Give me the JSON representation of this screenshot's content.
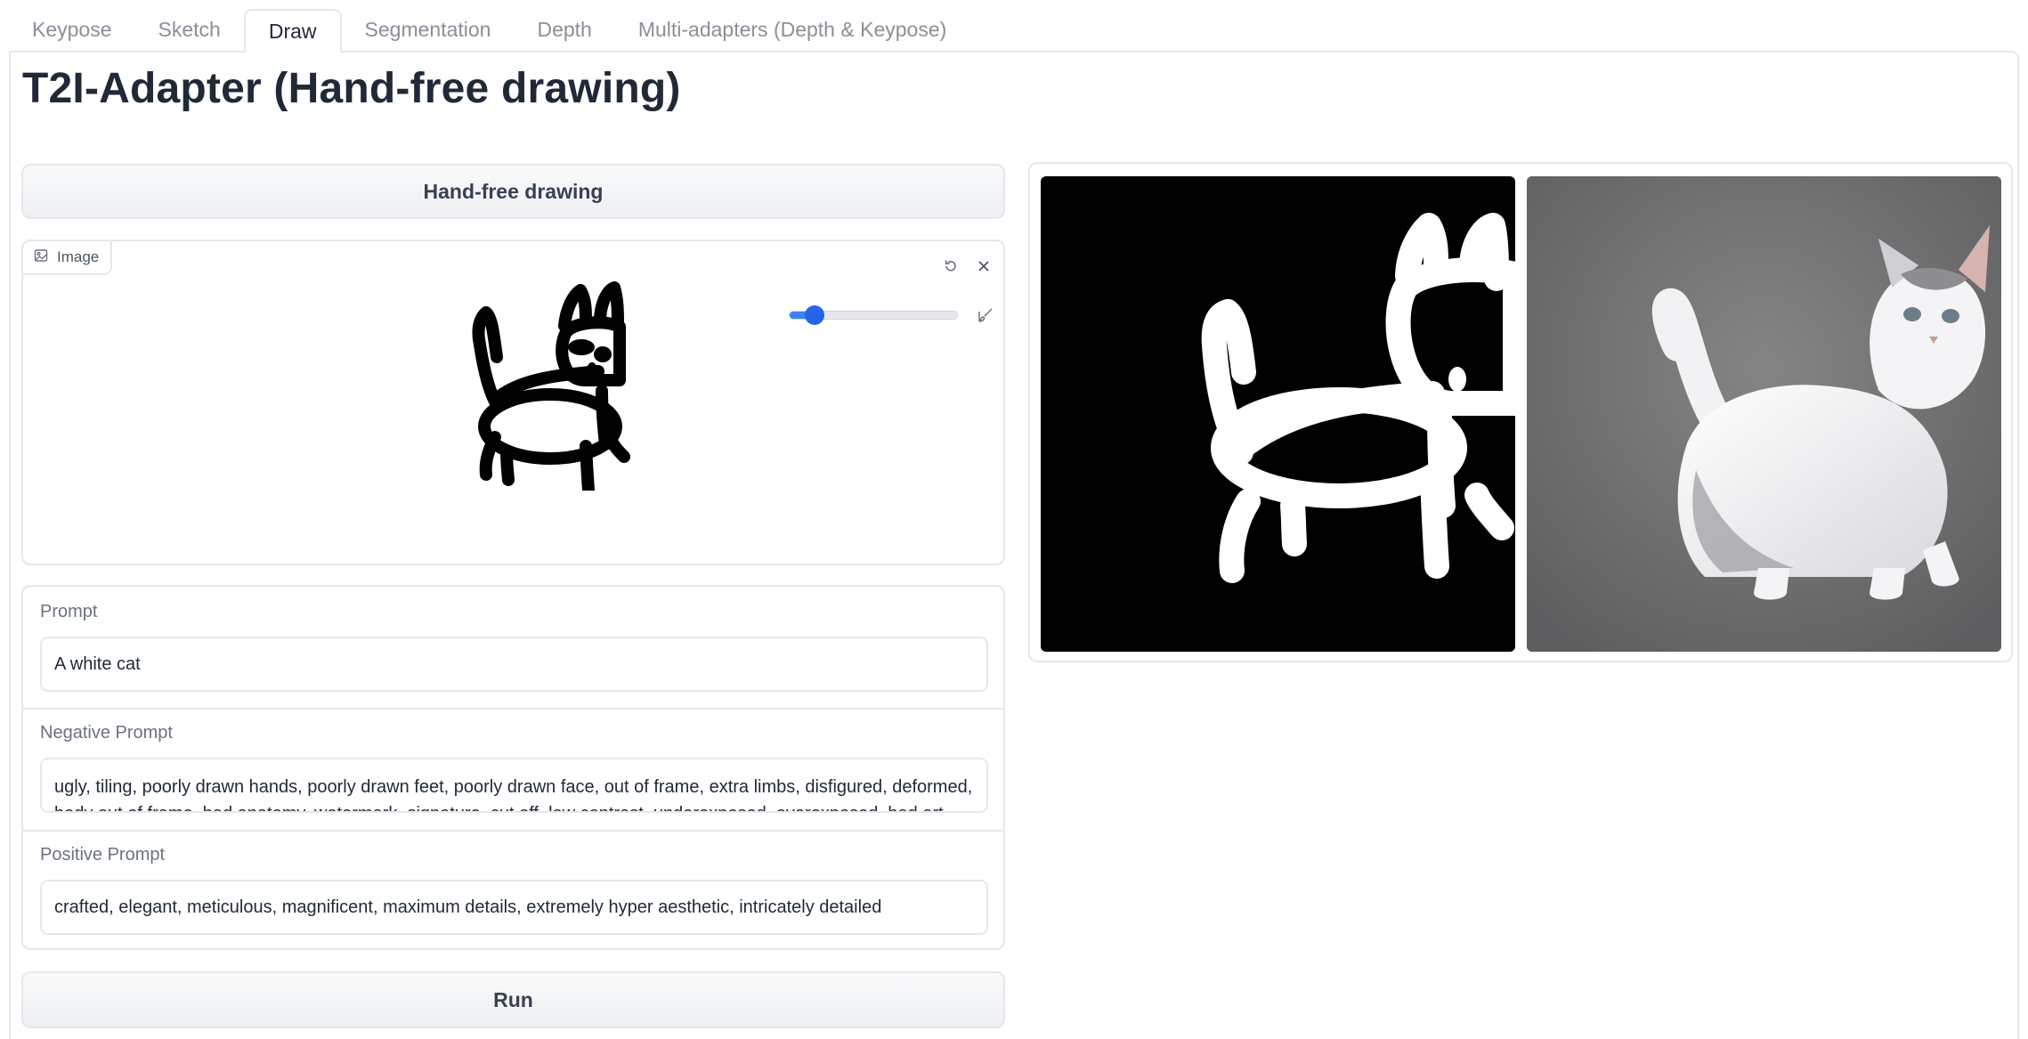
{
  "tabs": [
    "Keypose",
    "Sketch",
    "Draw",
    "Segmentation",
    "Depth",
    "Multi-adapters (Depth & Keypose)"
  ],
  "page_title": "T2I-Adapter (Hand-free drawing)",
  "mode_button": "Hand-free drawing",
  "image_block": {
    "label": "Image",
    "brush_size": 0.15
  },
  "prompt": {
    "label": "Prompt",
    "value": "A white cat"
  },
  "negative_prompt": {
    "label": "Negative Prompt",
    "value": "ugly, tiling, poorly drawn hands, poorly drawn feet, poorly drawn face, out of frame, extra limbs, disfigured, deformed, body out of frame, bad anatomy, watermark, signature, cut off, low contrast, underexposed, overexposed, bad art"
  },
  "positive_prompt": {
    "label": "Positive Prompt",
    "value": "crafted, elegant, meticulous, magnificent, maximum details, extremely hyper aesthetic, intricately detailed"
  },
  "run_button": "Run",
  "colors": {
    "accent": "#3b82f6",
    "border": "#e5e7eb",
    "text": "#1f2937"
  }
}
